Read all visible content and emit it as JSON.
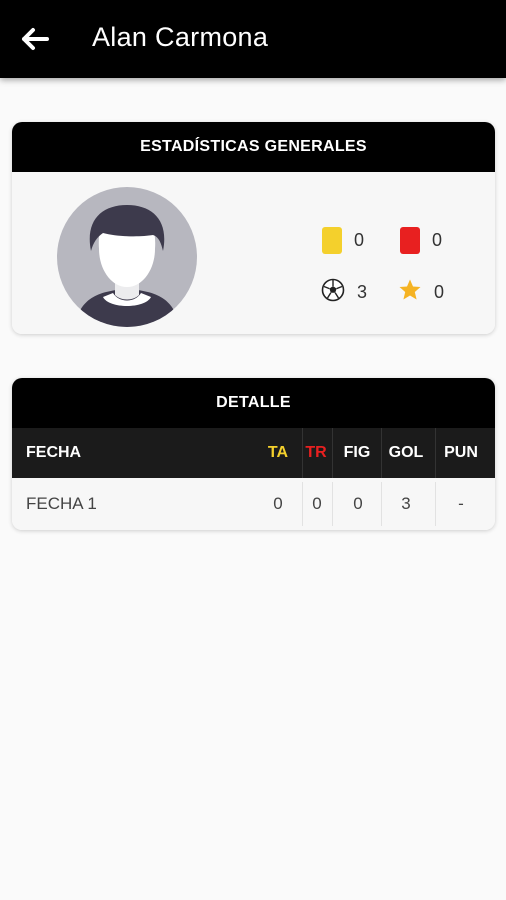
{
  "header": {
    "title": "Alan Carmona"
  },
  "general": {
    "title": "ESTADÍSTICAS GENERALES",
    "yellow_cards": "0",
    "red_cards": "0",
    "goals": "3",
    "stars": "0"
  },
  "detail": {
    "title": "DETALLE",
    "columns": {
      "fecha": "FECHA",
      "ta": "TA",
      "tr": "TR",
      "fig": "FIG",
      "gol": "GOL",
      "pun": "PUN"
    },
    "rows": [
      {
        "fecha": "FECHA 1",
        "ta": "0",
        "tr": "0",
        "fig": "0",
        "gol": "3",
        "pun": "-"
      }
    ]
  },
  "colors": {
    "yellow": "#f4d02c",
    "red": "#e82020",
    "bar": "#000000"
  }
}
